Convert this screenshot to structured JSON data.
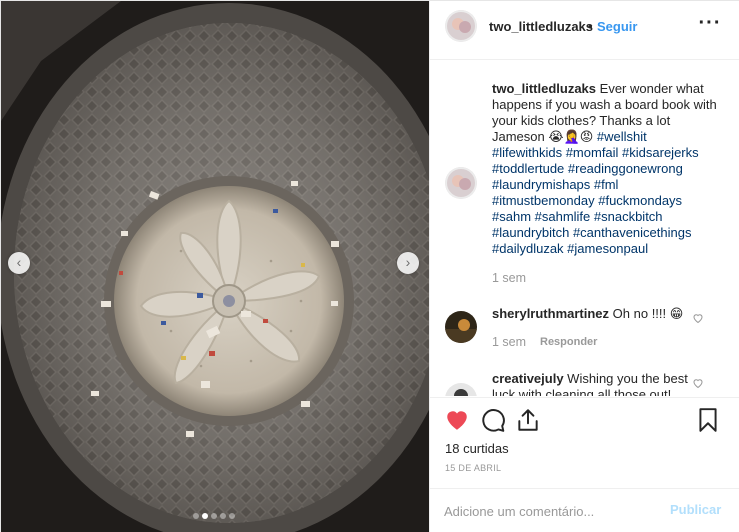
{
  "post": {
    "username": "two_littledluzaks",
    "separator": "•",
    "follow_label": "Seguir",
    "more_icon": "more-horizontal-icon",
    "photo_alt": "washing machine drum",
    "carousel": {
      "count": 5,
      "active_index": 1
    }
  },
  "caption": {
    "username": "two_littledluzaks",
    "text": "Ever wonder what happens if you wash a board book with your kids clothes? Thanks a lot Jameson 😭🤦‍♀️😡 ",
    "hashtags": "#wellshit #lifewithkids #momfail #kidsarejerks #toddlertude #readinggonewrong #laundrymishaps #fml #itmustbemonday #fuckmondays #sahm #sahmlife #snackbitch #laundrybitch #canthavenicethings #dailydluzak #jamesonpaul",
    "time": "1 sem"
  },
  "comments": [
    {
      "username": "sherylruthmartinez",
      "text": "Oh no !!!! 😁",
      "time": "1 sem",
      "reply_label": "Responder"
    },
    {
      "username": "creativejuly",
      "text": "Wishing you the best luck with cleaning all those out!"
    }
  ],
  "actions": {
    "like_icon": "heart-filled-icon",
    "comment_icon": "comment-icon",
    "share_icon": "share-icon",
    "save_icon": "bookmark-icon",
    "likes_text": "18 curtidas",
    "date": "15 DE ABRIL"
  },
  "comment_box": {
    "placeholder": "Adicione um comentário...",
    "publish_label": "Publicar"
  },
  "colors": {
    "link_blue": "#3897f0",
    "like_red": "#ed4956",
    "hashtag": "#003569",
    "muted": "#999999",
    "publish_disabled": "#b2dffc"
  }
}
